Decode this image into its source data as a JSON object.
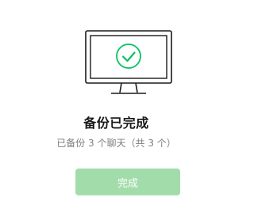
{
  "dialog": {
    "illustration_icon": "monitor-checkmark-icon",
    "title": "备份已完成",
    "subtitle": "已备份 3 个聊天（共 3 个）",
    "done_button_label": "完成"
  },
  "colors": {
    "accent_green": "#07c160",
    "button_disabled_green": "#a3dcab",
    "title_text": "#191919",
    "subtitle_text": "#7f7f7f",
    "illustration_stroke": "#1a1a1a"
  }
}
